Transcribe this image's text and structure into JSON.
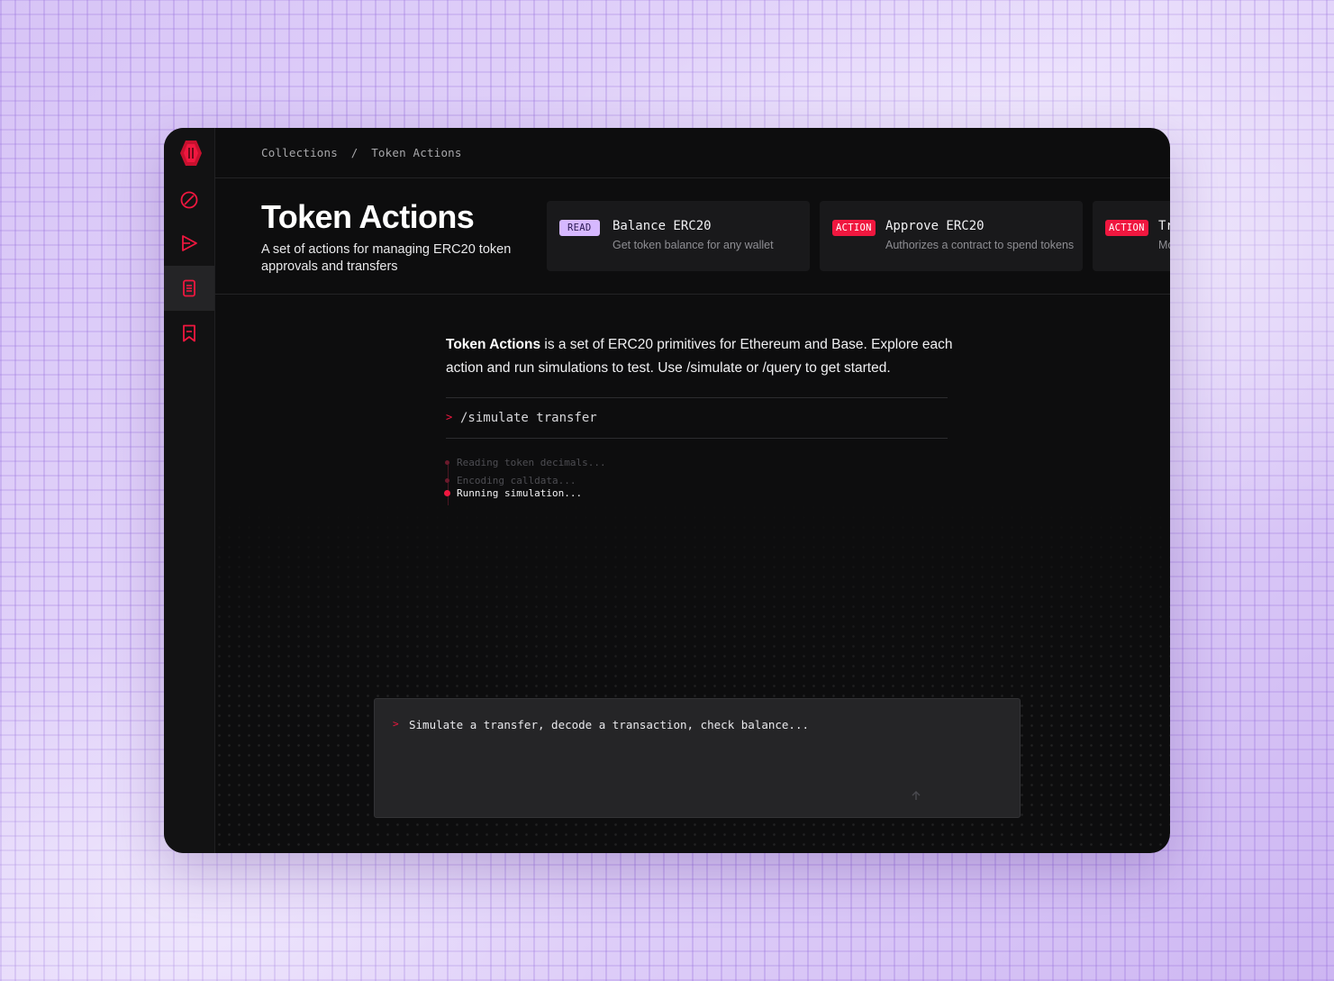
{
  "breadcrumb": {
    "root": "Collections",
    "separator": "/",
    "current": "Token Actions"
  },
  "header": {
    "title": "Token Actions",
    "subtitle": "A set of actions for managing ERC20 token approvals and transfers"
  },
  "cards": [
    {
      "badge": "READ",
      "title": "Balance ERC20",
      "description": "Get token balance for any wallet"
    },
    {
      "badge": "ACTION",
      "title": "Approve ERC20",
      "description": "Authorizes a contract to spend tokens"
    },
    {
      "badge": "ACTION",
      "title": "Tr",
      "description": "Mo"
    }
  ],
  "intro": {
    "bold": "Token Actions",
    "rest": " is a set of ERC20 primitives for Ethereum and Base.  Explore each action and run simulations to test. Use /simulate or /query to get started."
  },
  "command": {
    "caret": ">",
    "text": "/simulate transfer"
  },
  "steps": [
    {
      "label": "Reading token decimals...",
      "state": "done"
    },
    {
      "label": "Encoding calldata...",
      "state": "done"
    },
    {
      "label": "Running simulation...",
      "state": "active"
    }
  ],
  "composer": {
    "caret": ">",
    "placeholder": "Simulate a transfer, decode a transaction, check balance..."
  },
  "sidebar": {
    "items": [
      {
        "icon": "compass-icon",
        "active": false
      },
      {
        "icon": "play-icon",
        "active": false
      },
      {
        "icon": "collection-icon",
        "active": true
      },
      {
        "icon": "bookmark-icon",
        "active": false
      }
    ]
  },
  "colors": {
    "accent": "#f0173f",
    "read_badge": "#d6b8ff",
    "window_bg": "#0d0d0e",
    "card_bg": "#19191b"
  }
}
